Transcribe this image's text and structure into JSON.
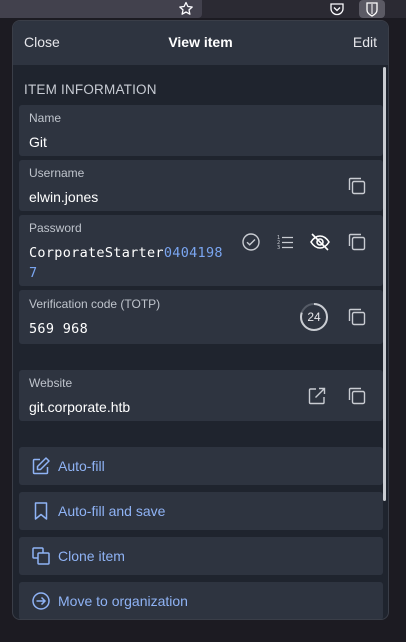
{
  "browser": {
    "icons": [
      "star-icon",
      "pocket-icon",
      "bitwarden-extension-icon"
    ]
  },
  "header": {
    "close_label": "Close",
    "title": "View item",
    "edit_label": "Edit"
  },
  "section": {
    "title": "ITEM INFORMATION"
  },
  "fields": {
    "name": {
      "label": "Name",
      "value": "Git"
    },
    "username": {
      "label": "Username",
      "value": "elwin.jones"
    },
    "password": {
      "label": "Password",
      "value_text": "CorporateStarter",
      "value_digits_line1": "0404198",
      "value_digits_line2": "7"
    },
    "totp": {
      "label": "Verification code (TOTP)",
      "value": "569 968",
      "countdown": "24",
      "countdown_fraction": 0.8
    },
    "website": {
      "label": "Website",
      "value": "git.corporate.htb"
    }
  },
  "actions": [
    {
      "label": "Auto-fill",
      "icon": "edit-icon"
    },
    {
      "label": "Auto-fill and save",
      "icon": "bookmark-icon"
    },
    {
      "label": "Clone item",
      "icon": "clone-icon"
    },
    {
      "label": "Move to organization",
      "icon": "arrow-circle-right-icon"
    }
  ],
  "colors": {
    "popup_bg": "#1f242e",
    "card_bg": "#2e3440",
    "accent_link": "#8fb3f5",
    "password_number": "#7aa5f0"
  }
}
